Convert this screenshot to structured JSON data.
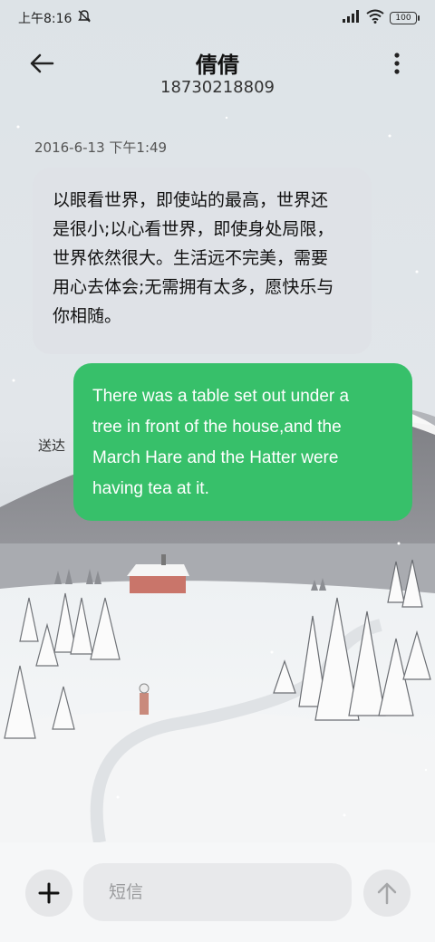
{
  "status_bar": {
    "time": "上午8:16",
    "battery": "100",
    "icons": [
      "do-not-disturb-icon",
      "signal-icon",
      "wifi-icon",
      "battery-icon"
    ]
  },
  "header": {
    "contact_name": "倩倩",
    "contact_number": "18730218809",
    "icons": [
      "back-arrow-icon",
      "more-vertical-icon"
    ]
  },
  "conversation": {
    "timestamp": "2016-6-13 下午1:49",
    "incoming": {
      "lines": [
        "以眼看世界，即使站的最高，世界还",
        "是很小;以心看世界，即使身处局限，",
        "世界依然很大。生活远不完美，需要",
        "用心去体会;无需拥有太多，愿快乐与",
        "你相随。"
      ]
    },
    "outgoing": {
      "lines": [
        "There was a table set out under a",
        "tree in front of the house,and the",
        "March Hare and the Hatter were",
        "having tea at it."
      ],
      "status": "送达"
    }
  },
  "composer": {
    "placeholder": "短信",
    "value": "",
    "icons": [
      "plus-icon",
      "send-arrow-up-icon"
    ]
  },
  "colors": {
    "outgoing_bubble": "#37c06a",
    "incoming_bubble": "#dee2e6",
    "composer_bg": "#f6f7f8"
  }
}
